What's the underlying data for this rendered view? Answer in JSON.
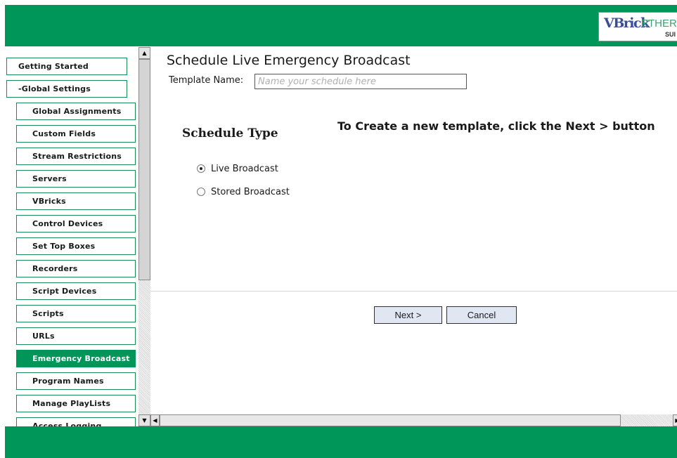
{
  "brand": {
    "logo_primary": "VBrick",
    "logo_secondary": "ETHERNET",
    "logo_tertiary": "SUI",
    "bar_color": "#00965a"
  },
  "sidebar": {
    "top_items": [
      {
        "label": "Getting Started"
      },
      {
        "label": "-Global Settings"
      }
    ],
    "sub_items": [
      {
        "label": "Global Assignments"
      },
      {
        "label": "Custom Fields"
      },
      {
        "label": "Stream Restrictions"
      },
      {
        "label": "Servers"
      },
      {
        "label": "VBricks"
      },
      {
        "label": "Control Devices"
      },
      {
        "label": "Set Top Boxes"
      },
      {
        "label": "Recorders"
      },
      {
        "label": "Script Devices"
      },
      {
        "label": "Scripts"
      },
      {
        "label": "URLs"
      },
      {
        "label": "Emergency Broadcast",
        "active": true
      },
      {
        "label": "Program Names"
      },
      {
        "label": "Manage PlayLists"
      },
      {
        "label": "Access Logging"
      }
    ]
  },
  "main": {
    "title": "Schedule Live Emergency Broadcast",
    "template_label": "Template Name:",
    "template_placeholder": "Name your schedule here",
    "create_hint": "To Create a new template, click the Next > button",
    "schedule_type": {
      "heading": "Schedule Type",
      "options": [
        {
          "label": "Live Broadcast",
          "selected": true
        },
        {
          "label": "Stored Broadcast",
          "selected": false
        }
      ]
    }
  },
  "actions": {
    "next_label": "Next >",
    "cancel_label": "Cancel"
  },
  "scrollbars": {
    "up_icon": "▲",
    "down_icon": "▼",
    "left_icon": "◀",
    "right_icon": "▶"
  }
}
